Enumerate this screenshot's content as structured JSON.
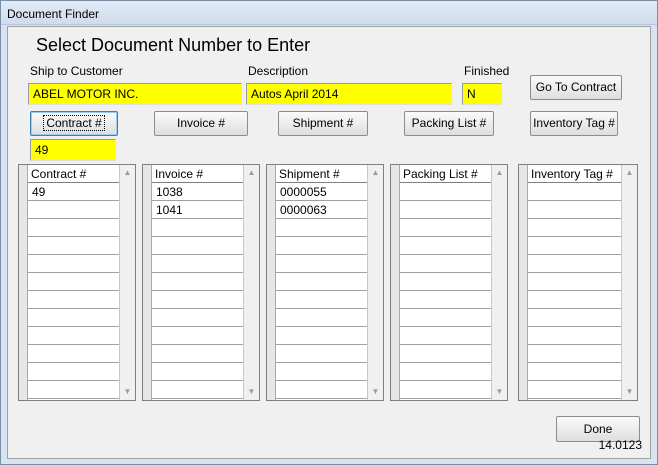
{
  "window": {
    "title": "Document Finder"
  },
  "heading": "Select Document Number to Enter",
  "fields": {
    "ship_to": {
      "label": "Ship to Customer",
      "value": "ABEL MOTOR INC."
    },
    "description": {
      "label": "Description",
      "value": "Autos April 2014"
    },
    "finished": {
      "label": "Finished",
      "value": "N"
    },
    "contract_value": "49"
  },
  "buttons": {
    "go_to_contract": "Go To Contract",
    "contract": "Contract #",
    "invoice": "Invoice #",
    "shipment": "Shipment #",
    "packing_list": "Packing List #",
    "inventory_tag": "Inventory Tag #",
    "done": "Done"
  },
  "lists": {
    "contract": {
      "header": "Contract #",
      "rows": [
        "49"
      ]
    },
    "invoice": {
      "header": "Invoice #",
      "rows": [
        "1038",
        "1041"
      ]
    },
    "shipment": {
      "header": "Shipment #",
      "rows": [
        "0000055",
        "0000063"
      ]
    },
    "packing_list": {
      "header": "Packing List #",
      "rows": []
    },
    "inventory_tag": {
      "header": "Inventory Tag #",
      "rows": []
    }
  },
  "version": "14.0123",
  "icons": {
    "scroll_up": "scroll-up-arrow-icon",
    "scroll_down": "scroll-down-arrow-icon"
  }
}
